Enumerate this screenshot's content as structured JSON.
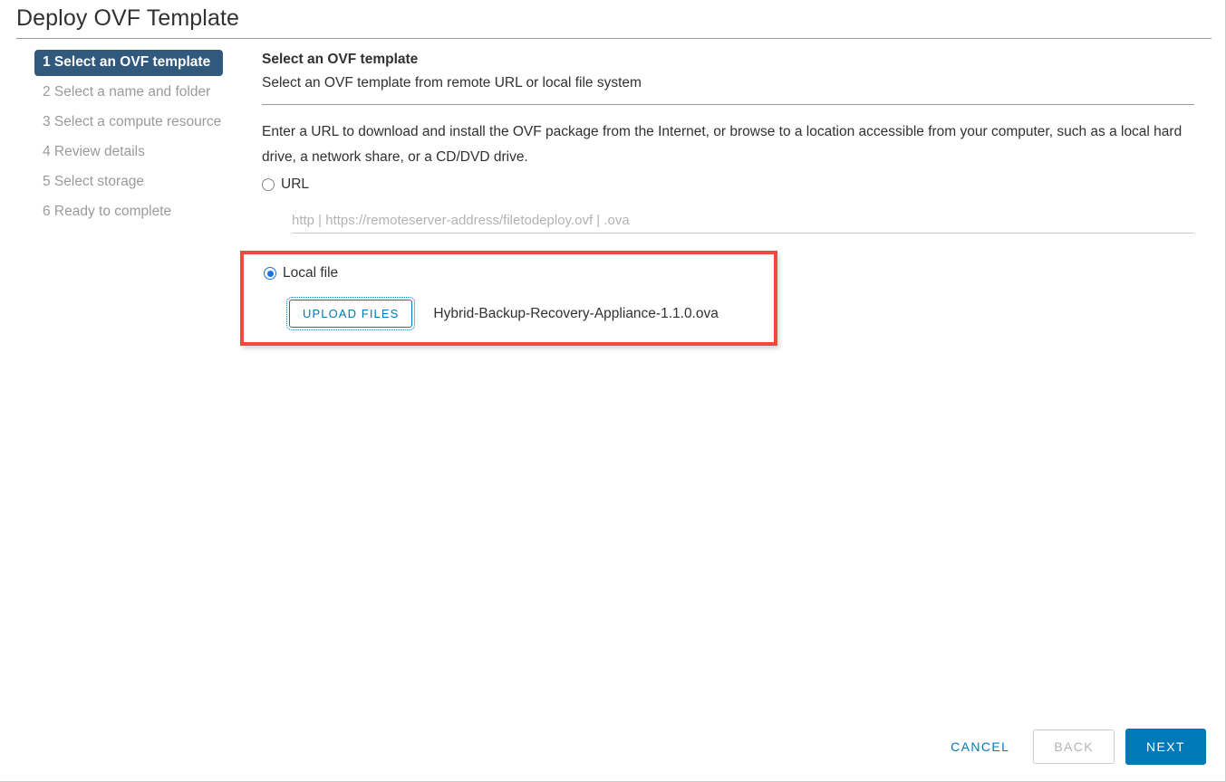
{
  "window": {
    "title": "Deploy OVF Template"
  },
  "sidebar": {
    "steps": [
      {
        "label": "1 Select an OVF template",
        "active": true
      },
      {
        "label": "2 Select a name and folder",
        "active": false
      },
      {
        "label": "3 Select a compute resource",
        "active": false
      },
      {
        "label": "4 Review details",
        "active": false
      },
      {
        "label": "5 Select storage",
        "active": false
      },
      {
        "label": "6 Ready to complete",
        "active": false
      }
    ]
  },
  "main": {
    "panel_title": "Select an OVF template",
    "panel_subtitle": "Select an OVF template from remote URL or local file system",
    "description": "Enter a URL to download and install the OVF package from the Internet, or browse to a location accessible from your computer, such as a local hard drive, a network share, or a CD/DVD drive.",
    "source_options": {
      "url": {
        "label": "URL",
        "selected": false,
        "input_value": "",
        "input_placeholder": "http | https://remoteserver-address/filetodeploy.ovf | .ova"
      },
      "local_file": {
        "label": "Local file",
        "selected": true,
        "upload_button_label": "UPLOAD FILES",
        "selected_file_name": "Hybrid-Backup-Recovery-Appliance-1.1.0.ova"
      }
    }
  },
  "footer": {
    "cancel_label": "CANCEL",
    "back_label": "BACK",
    "next_label": "NEXT"
  },
  "colors": {
    "accent_blue": "#0079b8",
    "active_step_bg": "#30597d",
    "highlight_red": "#f4473d",
    "radio_blue": "#1a73d6",
    "muted_text": "#9a9a9a"
  }
}
